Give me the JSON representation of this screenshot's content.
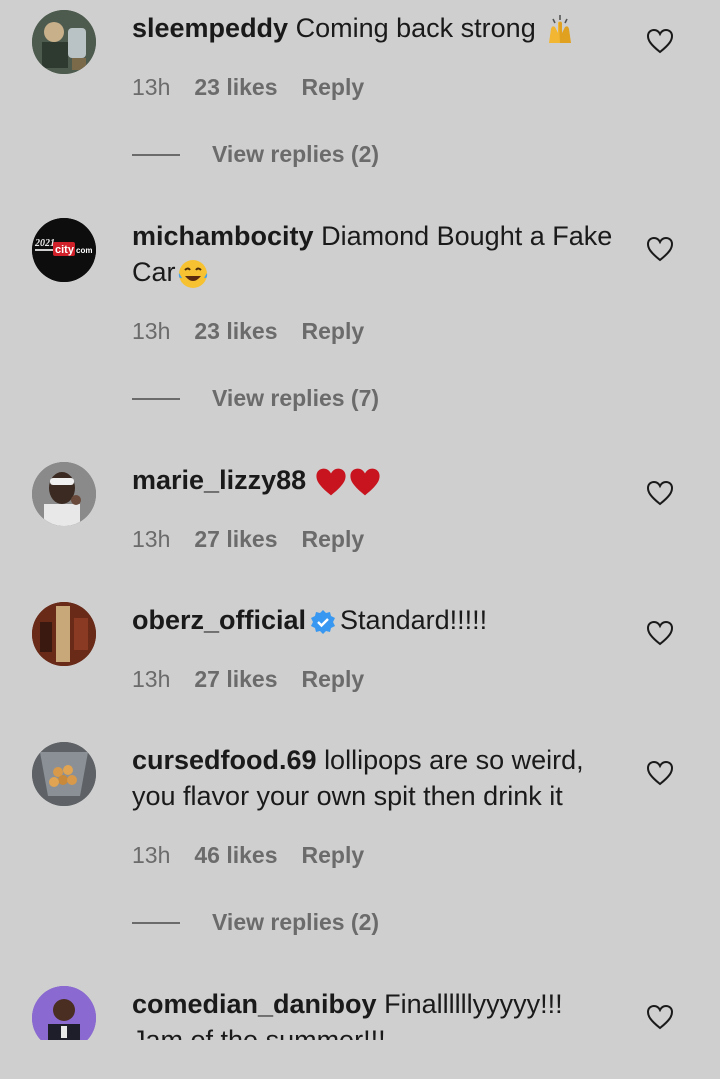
{
  "comments": [
    {
      "user": "sleempeddy",
      "text": "Coming back strong",
      "emoji": "raising-hands",
      "time": "13h",
      "likes": "23 likes",
      "reply": "Reply",
      "view_replies": "View replies (2)"
    },
    {
      "user": "michambocity",
      "text_line1": "Diamond Bought a Fake",
      "text_line2": "Car",
      "emoji": "tears-of-joy",
      "time": "13h",
      "likes": "23 likes",
      "reply": "Reply",
      "view_replies": "View replies (7)",
      "avatar_text": "2021",
      "avatar_brand": "city",
      "avatar_suffix": "com"
    },
    {
      "user": "marie_lizzy88",
      "emoji": "two-red-hearts",
      "time": "13h",
      "likes": "27 likes",
      "reply": "Reply"
    },
    {
      "user": "oberz_official",
      "text": "Standard!!!!!",
      "time": "13h",
      "likes": "27 likes",
      "reply": "Reply"
    },
    {
      "user": "cursedfood.69",
      "text_line1": "lollipops are so weird,",
      "text_line2": "you flavor your own spit then drink it",
      "time": "13h",
      "likes": "46 likes",
      "reply": "Reply",
      "view_replies": "View replies (2)"
    },
    {
      "user": "comedian_daniboy",
      "text_line1": "Finallllllyyyyy!!!",
      "text_line2": "Jam of the summer!!!"
    }
  ]
}
